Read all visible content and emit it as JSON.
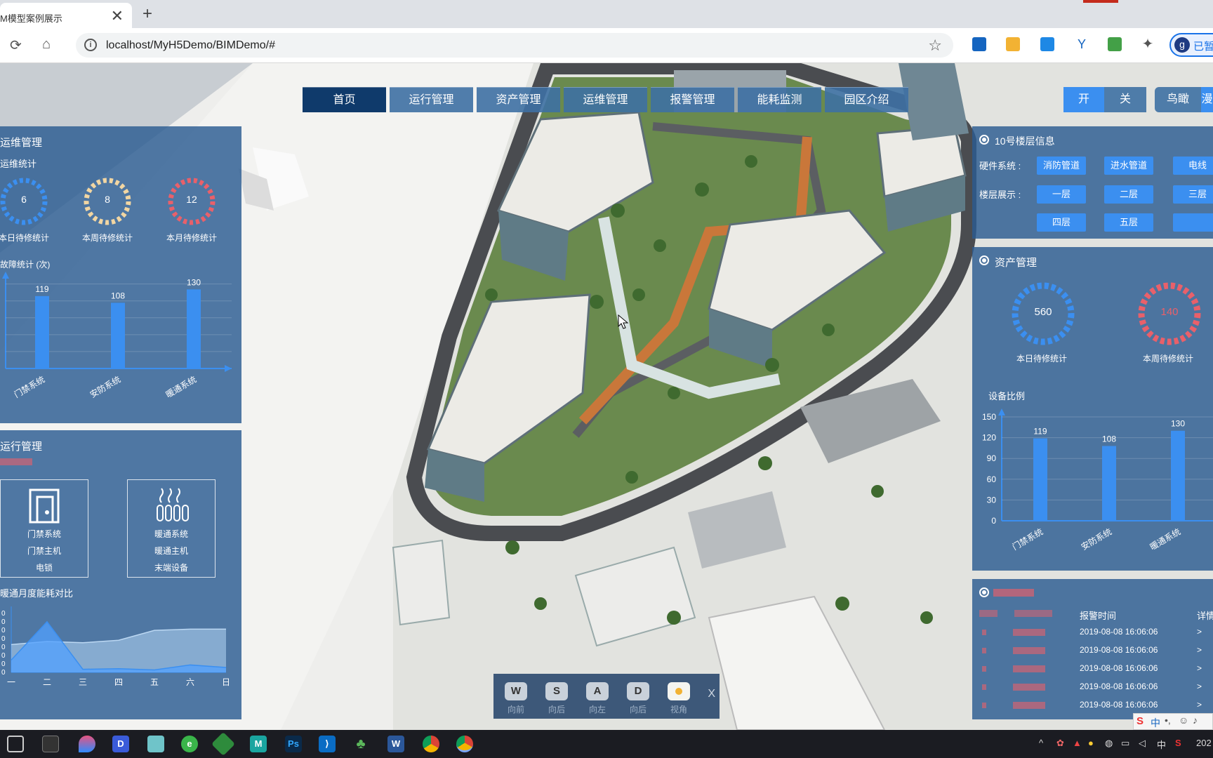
{
  "browser": {
    "tab_title": "M模型案例展示",
    "tab_close": "✕",
    "new_tab": "+",
    "url": "localhost/MyH5Demo/BIMDemo/#",
    "profile_initial": "g",
    "profile_label": "已暂"
  },
  "topnav": {
    "items": [
      "首页",
      "运行管理",
      "资产管理",
      "运维管理",
      "报警管理",
      "能耗监测",
      "园区介绍"
    ],
    "active_index": 0,
    "switch_on": "开",
    "switch_off": "关",
    "view_label": "鸟瞰",
    "view_label2": "漫"
  },
  "left_maint": {
    "title": "运维管理",
    "subtitle": "运维统计",
    "rings": [
      {
        "value": "6",
        "caption": "本日待修统计",
        "color": "#3b8ff0"
      },
      {
        "value": "8",
        "caption": "本周待修统计",
        "color": "#f2d6a2"
      },
      {
        "value": "12",
        "caption": "本月待修统计",
        "color": "#e9606a"
      }
    ],
    "fault_label": "故障统计 (次)"
  },
  "left_ops": {
    "title": "运行管理",
    "subtitle_red": "",
    "cards": [
      {
        "lines": [
          "门禁系统",
          "门禁主机",
          "电锁"
        ]
      },
      {
        "lines": [
          "暖通系统",
          "暖通主机",
          "末端设备"
        ]
      }
    ],
    "energy_label": "暖通月度能耗对比"
  },
  "right_floor": {
    "title": "10号楼层信息",
    "hardware_label": "硬件系统 :",
    "floor_label": "楼层展示 :",
    "hardware_buttons": [
      "消防管道",
      "进水管道",
      "电线"
    ],
    "floor_buttons_row1": [
      "一层",
      "二层",
      "三层"
    ],
    "floor_buttons_row2": [
      "四层",
      "五层",
      ""
    ]
  },
  "right_asset": {
    "title": "资产管理",
    "rings": [
      {
        "value": "560",
        "caption": "本日待修统计",
        "color": "#3b8ff0"
      },
      {
        "value": "140",
        "caption": "本周待修统计",
        "color": "#e9606a"
      }
    ],
    "ratio_label": "设备比例"
  },
  "right_alarm": {
    "title": "",
    "headers": [
      "",
      "",
      "报警时间",
      "详情"
    ],
    "rows": [
      {
        "time": "2019-08-08  16:06:06",
        "detail": ">"
      },
      {
        "time": "2019-08-08  16:06:06",
        "detail": ">"
      },
      {
        "time": "2019-08-08  16:06:06",
        "detail": ">"
      },
      {
        "time": "2019-08-08  16:06:06",
        "detail": ">"
      },
      {
        "time": "2019-08-08  16:06:06",
        "detail": ">"
      }
    ]
  },
  "controls": {
    "keys": [
      {
        "key": "W",
        "caption": "向前"
      },
      {
        "key": "S",
        "caption": "向后"
      },
      {
        "key": "A",
        "caption": "向左"
      },
      {
        "key": "D",
        "caption": "向后"
      },
      {
        "key": "",
        "caption": "视角"
      }
    ],
    "close": "X"
  },
  "taskbar": {
    "tray_ime": "中",
    "tray_lang": "中",
    "clock": "202"
  },
  "chart_data": [
    {
      "type": "bar",
      "categories": [
        "门禁系统",
        "安防系统",
        "暖通系统"
      ],
      "values": [
        119,
        108,
        130
      ],
      "title": "",
      "xlabel": "",
      "ylabel": "",
      "ylim": [
        0,
        150
      ]
    },
    {
      "type": "bar",
      "categories": [
        "门禁系统",
        "安防系统",
        "暖通系统"
      ],
      "values": [
        119,
        108,
        130
      ],
      "title": "设备比例",
      "yticks": [
        0,
        30,
        60,
        90,
        120,
        150
      ],
      "ylim": [
        0,
        150
      ]
    },
    {
      "type": "area",
      "categories": [
        "一",
        "二",
        "三",
        "四",
        "五",
        "六",
        "日"
      ],
      "series": [
        {
          "values": [
            20,
            82,
            5,
            6,
            4,
            12,
            8
          ]
        },
        {
          "values": [
            45,
            50,
            48,
            52,
            68,
            70,
            70
          ]
        }
      ],
      "ylim": [
        0,
        100
      ]
    }
  ]
}
